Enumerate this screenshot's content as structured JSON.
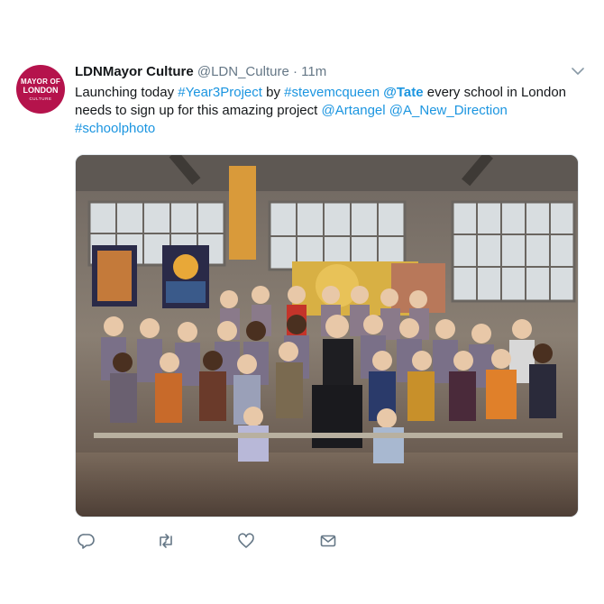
{
  "tweet": {
    "avatar": {
      "line1": "MAYOR OF",
      "line2": "LONDON",
      "line3": "CULTURE",
      "color": "#b5134c"
    },
    "display_name": "LDNMayor Culture",
    "handle": "@LDN_Culture",
    "separator": "·",
    "time": "11m",
    "text": {
      "t1": "Launching today ",
      "hashtag1": "#Year3Project",
      "t2": " by ",
      "hashtag2": "#stevemcqueen",
      "t3": " ",
      "mention1": "@Tate",
      "t4": " every school in London needs to sign up for this amazing project ",
      "mention2": "@Artangel",
      "t5": " ",
      "mention3": "@A_New_Direction",
      "t6": " ",
      "hashtag3": "#schoolphoto"
    },
    "link_color": "#1b95e0",
    "actions": [
      "reply-icon",
      "retweet-icon",
      "like-icon",
      "direct-message-icon"
    ]
  }
}
